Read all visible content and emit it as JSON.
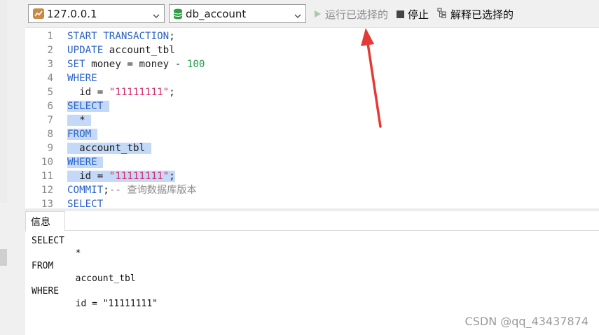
{
  "toolbar": {
    "connection": "127.0.0.1",
    "database": "db_account",
    "run_selected_label": "运行已选择的",
    "stop_label": "停止",
    "explain_label": "解释已选择的"
  },
  "editor": {
    "lines": [
      {
        "n": "1",
        "segs": [
          {
            "t": "START TRANSACTION",
            "c": "kw"
          },
          {
            "t": ";",
            "c": "tx"
          }
        ]
      },
      {
        "n": "2",
        "segs": [
          {
            "t": "UPDATE",
            "c": "kw"
          },
          {
            "t": " account_tbl",
            "c": "tx"
          }
        ]
      },
      {
        "n": "3",
        "segs": [
          {
            "t": "SET",
            "c": "kw"
          },
          {
            "t": " money = money - ",
            "c": "tx"
          },
          {
            "t": "100",
            "c": "num"
          }
        ]
      },
      {
        "n": "4",
        "segs": [
          {
            "t": "WHERE",
            "c": "kw"
          }
        ]
      },
      {
        "n": "5",
        "segs": [
          {
            "t": "  id = ",
            "c": "tx"
          },
          {
            "t": "\"11111111\"",
            "c": "str"
          },
          {
            "t": ";",
            "c": "tx"
          }
        ]
      },
      {
        "n": "6",
        "segs": [
          {
            "t": "SELECT ",
            "c": "kw",
            "sel": true
          }
        ]
      },
      {
        "n": "7",
        "segs": [
          {
            "t": "  * ",
            "c": "tx",
            "sel": true
          }
        ]
      },
      {
        "n": "8",
        "segs": [
          {
            "t": "FROM ",
            "c": "kw",
            "sel": true
          }
        ]
      },
      {
        "n": "9",
        "segs": [
          {
            "t": "  account_tbl ",
            "c": "tx",
            "sel": true
          }
        ]
      },
      {
        "n": "10",
        "segs": [
          {
            "t": "WHERE ",
            "c": "kw",
            "sel": true
          }
        ]
      },
      {
        "n": "11",
        "segs": [
          {
            "t": "  id = ",
            "c": "tx",
            "sel": true
          },
          {
            "t": "\"11111111\"",
            "c": "str",
            "sel": true
          },
          {
            "t": ";",
            "c": "tx",
            "sel": true
          }
        ]
      },
      {
        "n": "12",
        "segs": [
          {
            "t": "COMMIT",
            "c": "kw"
          },
          {
            "t": ";",
            "c": "tx"
          },
          {
            "t": "-- 查询数据库版本",
            "c": "cm"
          }
        ]
      },
      {
        "n": "13",
        "segs": [
          {
            "t": "SELECT",
            "c": "kw"
          }
        ]
      }
    ]
  },
  "result": {
    "tab_label": "信息",
    "lines": [
      "SELECT",
      "        *",
      "FROM",
      "        account_tbl",
      "WHERE",
      "        id = \"11111111\""
    ]
  },
  "watermark": "CSDN @qq_43437874",
  "colors": {
    "keyword": "#2b63c9",
    "string": "#d32f6b",
    "number": "#21a04e",
    "comment": "#8a8a8a",
    "selection": "#c3d9f7",
    "annotation_arrow": "#e53935"
  }
}
